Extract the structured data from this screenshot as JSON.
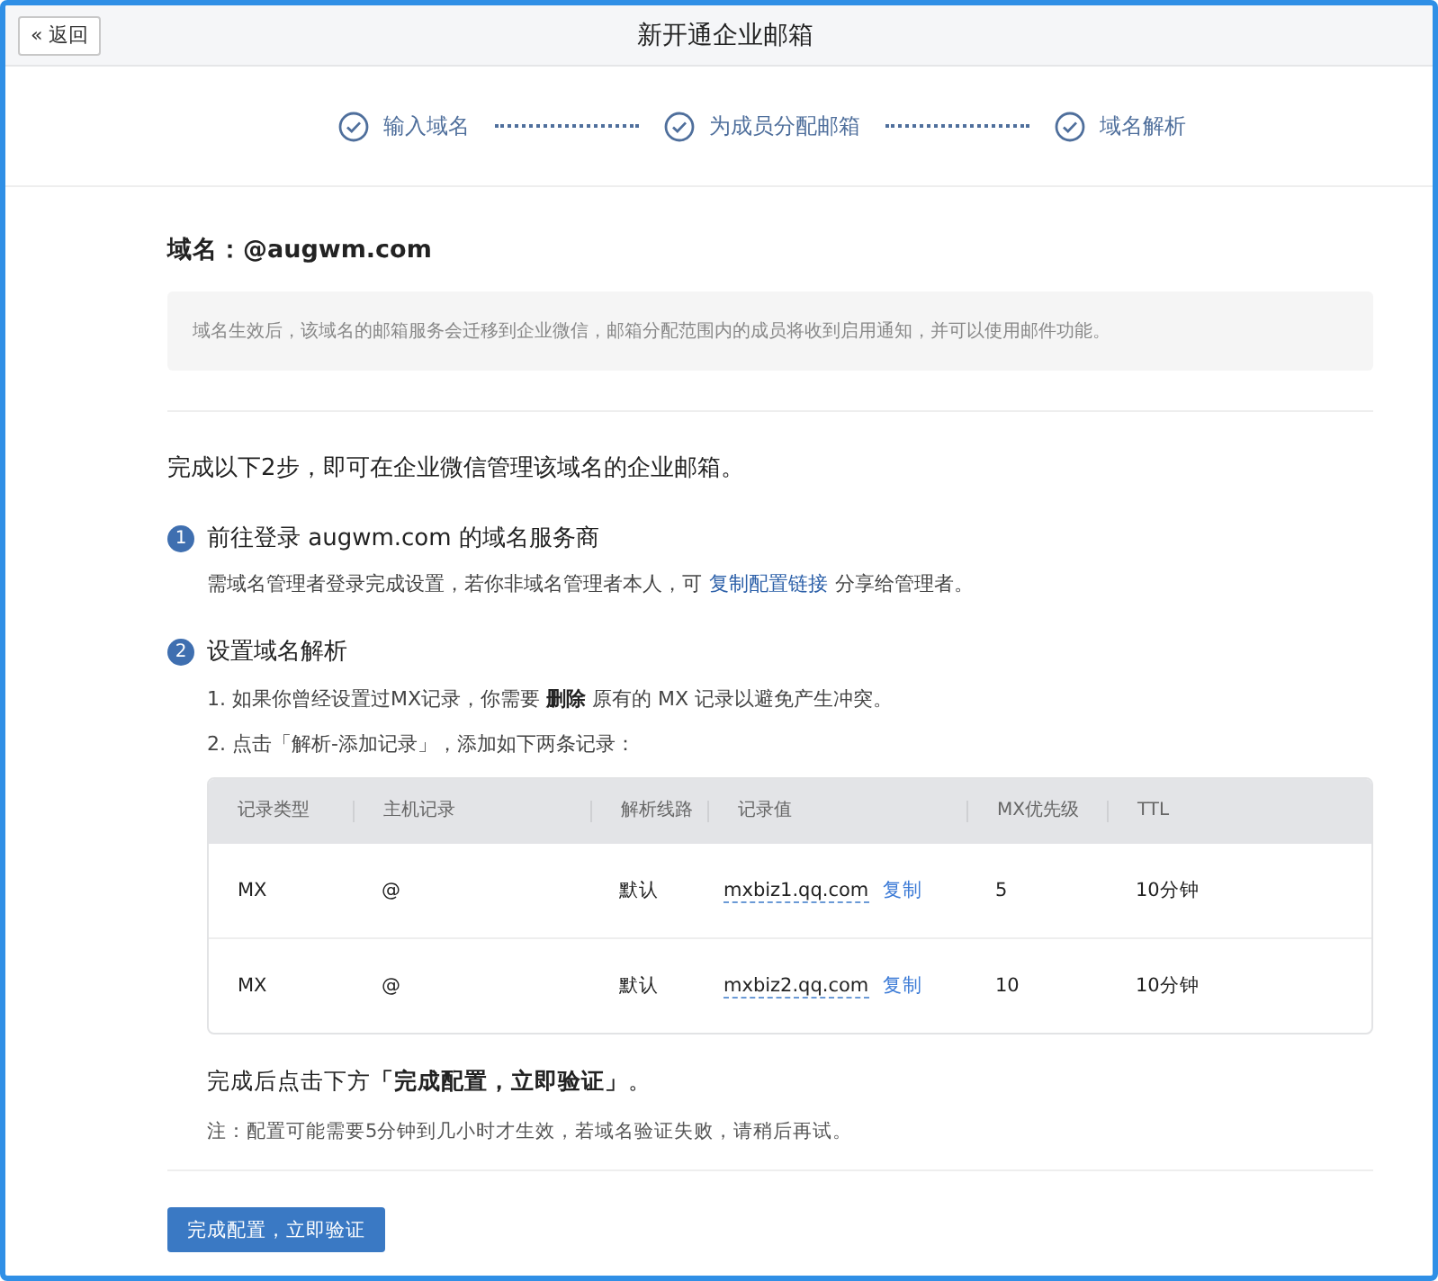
{
  "header": {
    "back_button": "« 返回",
    "title": "新开通企业邮箱"
  },
  "steps": [
    {
      "label": "输入域名",
      "done": true
    },
    {
      "label": "为成员分配邮箱",
      "done": true
    },
    {
      "label": "域名解析",
      "done": true
    }
  ],
  "domain": {
    "label": "域名：@augwm.com",
    "notice": "域名生效后，该域名的邮箱服务会迁移到企业微信，邮箱分配范围内的成员将收到启用通知，并可以使用邮件功能。"
  },
  "intro": "完成以下2步，即可在企业微信管理该域名的企业邮箱。",
  "step1": {
    "number": "1",
    "title": "前往登录 augwm.com 的域名服务商",
    "text_before": "需域名管理者登录完成设置，若你非域名管理者本人，可",
    "link": "复制配置链接",
    "text_after": "分享给管理者。"
  },
  "step2": {
    "number": "2",
    "title": "设置域名解析",
    "instructions": [
      "1. 如果你曾经设置过MX记录，你需要 **删除** 原有的 MX 记录以避免产生冲突。",
      "2. 点击「解析-添加记录」，添加如下两条记录："
    ]
  },
  "table": {
    "columns": [
      "记录类型",
      "主机记录",
      "解析线路",
      "记录值",
      "MX优先级",
      "TTL"
    ],
    "rows": [
      {
        "type": "MX",
        "host": "@",
        "line": "默认",
        "value": "mxbiz1.qq.com",
        "copy": "复制",
        "priority": "5",
        "ttl": "10分钟"
      },
      {
        "type": "MX",
        "host": "@",
        "line": "默认",
        "value": "mxbiz2.qq.com",
        "copy": "复制",
        "priority": "10",
        "ttl": "10分钟"
      }
    ]
  },
  "finish_hint": "完成后点击下方**「完成配置，立即验证」**。",
  "note": "注：配置可能需要5分钟到几小时才生效，若域名验证失败，请稍后再试。",
  "submit_button": "完成配置，立即验证"
}
